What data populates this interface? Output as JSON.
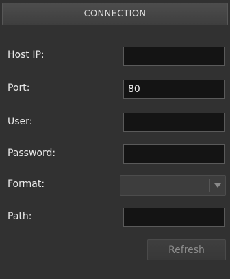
{
  "header": {
    "title": "CONNECTION"
  },
  "fields": {
    "host_ip": {
      "label": "Host IP:",
      "value": ""
    },
    "port": {
      "label": "Port:",
      "value": "80"
    },
    "user": {
      "label": "User:",
      "value": ""
    },
    "password": {
      "label": "Password:",
      "value": ""
    },
    "format": {
      "label": "Format:",
      "selected": ""
    },
    "path": {
      "label": "Path:",
      "value": ""
    }
  },
  "actions": {
    "refresh_label": "Refresh"
  },
  "icons": {
    "format_dropdown": "chevron-down-icon"
  }
}
